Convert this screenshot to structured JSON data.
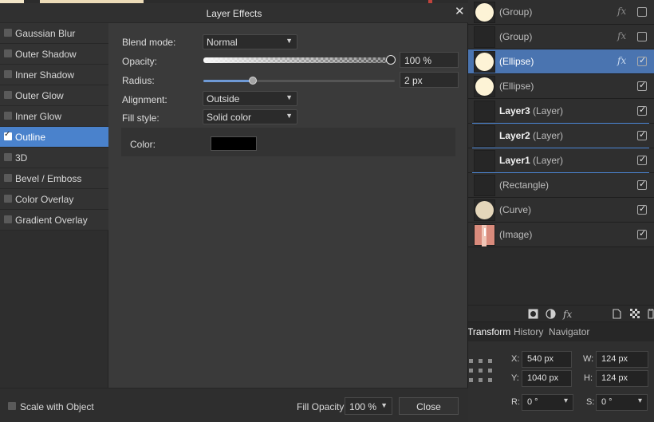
{
  "dialog": {
    "title": "Layer Effects",
    "close_icon": "close-icon",
    "effects": [
      {
        "label": "Gaussian Blur",
        "checked": false
      },
      {
        "label": "Outer Shadow",
        "checked": false
      },
      {
        "label": "Inner Shadow",
        "checked": false
      },
      {
        "label": "Outer Glow",
        "checked": false
      },
      {
        "label": "Inner Glow",
        "checked": false
      },
      {
        "label": "Outline",
        "checked": true,
        "selected": true
      },
      {
        "label": "3D",
        "checked": false
      },
      {
        "label": "Bevel / Emboss",
        "checked": false
      },
      {
        "label": "Color Overlay",
        "checked": false
      },
      {
        "label": "Gradient Overlay",
        "checked": false
      }
    ],
    "properties": {
      "blend_mode_label": "Blend mode:",
      "blend_mode_value": "Normal",
      "opacity_label": "Opacity:",
      "opacity_value": "100 %",
      "opacity_level": 1.0,
      "radius_label": "Radius:",
      "radius_value": "2 px",
      "radius_level": 0.26,
      "alignment_label": "Alignment:",
      "alignment_value": "Outside",
      "fill_style_label": "Fill style:",
      "fill_style_value": "Solid color",
      "color_label": "Color:",
      "color_value": "#000000"
    },
    "footer": {
      "scale_label": "Scale with Object",
      "scale_checked": false,
      "fill_opacity_label": "Fill Opacity:",
      "fill_opacity_value": "100 %",
      "close_label": "Close"
    }
  },
  "layers": [
    {
      "name": "(Group)",
      "thumb": "circle",
      "fx": true,
      "visible": false
    },
    {
      "name": "(Group)",
      "thumb": "empty",
      "fx": true,
      "visible": false
    },
    {
      "name": "(Ellipse)",
      "thumb": "circle",
      "fx": true,
      "visible": true,
      "selected": true
    },
    {
      "name": "(Ellipse)",
      "thumb": "circle",
      "fx": false,
      "visible": true
    },
    {
      "name": "Layer3",
      "kind": "(Layer)",
      "thumb": "empty",
      "fx": false,
      "visible": true
    },
    {
      "name": "Layer2",
      "kind": "(Layer)",
      "thumb": "empty",
      "fx": false,
      "visible": true
    },
    {
      "name": "Layer1",
      "kind": "(Layer)",
      "thumb": "empty",
      "fx": false,
      "visible": true
    },
    {
      "name": "(Rectangle)",
      "thumb": "empty",
      "fx": false,
      "visible": true
    },
    {
      "name": "(Curve)",
      "thumb": "beige",
      "fx": false,
      "visible": true
    },
    {
      "name": "(Image)",
      "thumb": "image",
      "fx": false,
      "visible": true
    }
  ],
  "layers_toolbar": {
    "icons": [
      "mask-icon",
      "adjustment-icon",
      "fx-icon",
      "new-layer-icon",
      "pixel-layer-icon",
      "delete-icon"
    ],
    "fx_glyph": "fx"
  },
  "transform_panel": {
    "tabs": [
      "Transform",
      "History",
      "Navigator"
    ],
    "active_tab": "Transform",
    "x_label": "X:",
    "x_value": "540 px",
    "y_label": "Y:",
    "y_value": "1040 px",
    "w_label": "W:",
    "w_value": "124 px",
    "h_label": "H:",
    "h_value": "124 px",
    "r_label": "R:",
    "r_value": "0 °",
    "s_label": "S:",
    "s_value": "0 °"
  },
  "colors": {
    "accent": "#4a82cc",
    "selected_layer": "#4a74b0",
    "dialog_bg": "#3a3a3a"
  }
}
